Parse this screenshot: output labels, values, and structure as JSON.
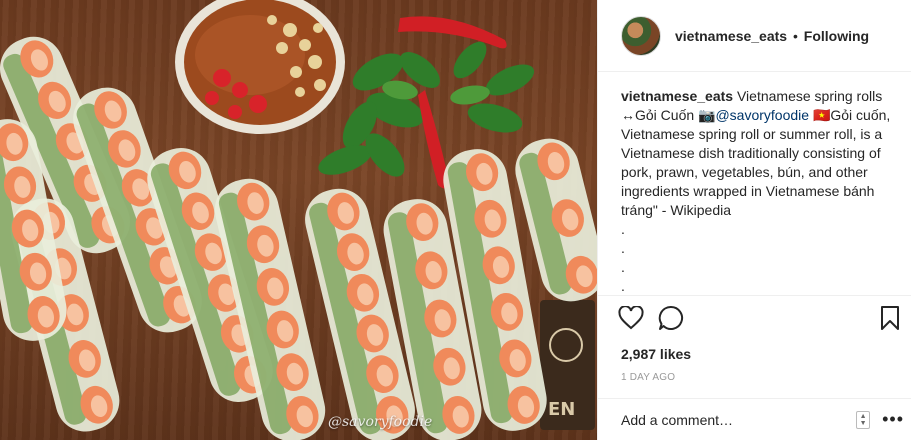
{
  "photo": {
    "watermark": "@savoryfoodie",
    "alt": "Vietnamese spring rolls with dipping sauce, chilies and basil"
  },
  "post": {
    "username": "vietnamese_eats",
    "separator": "•",
    "follow_status": "Following",
    "caption": {
      "username": "vietnamese_eats",
      "text_1": " Vietnamese spring rolls ↔Gỏi Cuốn 📷",
      "mention": "@savoryfoodie",
      "text_2": " 🇻🇳Gỏi cuốn, Vietnamese spring roll or summer roll, is a Vietnamese dish traditionally consisting of pork, prawn, vegetables, bún, and other ingredients wrapped in Vietnamese bánh tráng\" - Wikipedia",
      "dots": [
        ".",
        ".",
        ".",
        ".",
        "."
      ]
    },
    "likes": "2,987 likes",
    "timestamp": "1 DAY AGO",
    "comment_placeholder": "Add a comment…",
    "more_label": "•••",
    "icons": {
      "like": "heart-icon",
      "comment": "comment-icon",
      "save": "bookmark-icon",
      "more": "more-icon"
    }
  }
}
